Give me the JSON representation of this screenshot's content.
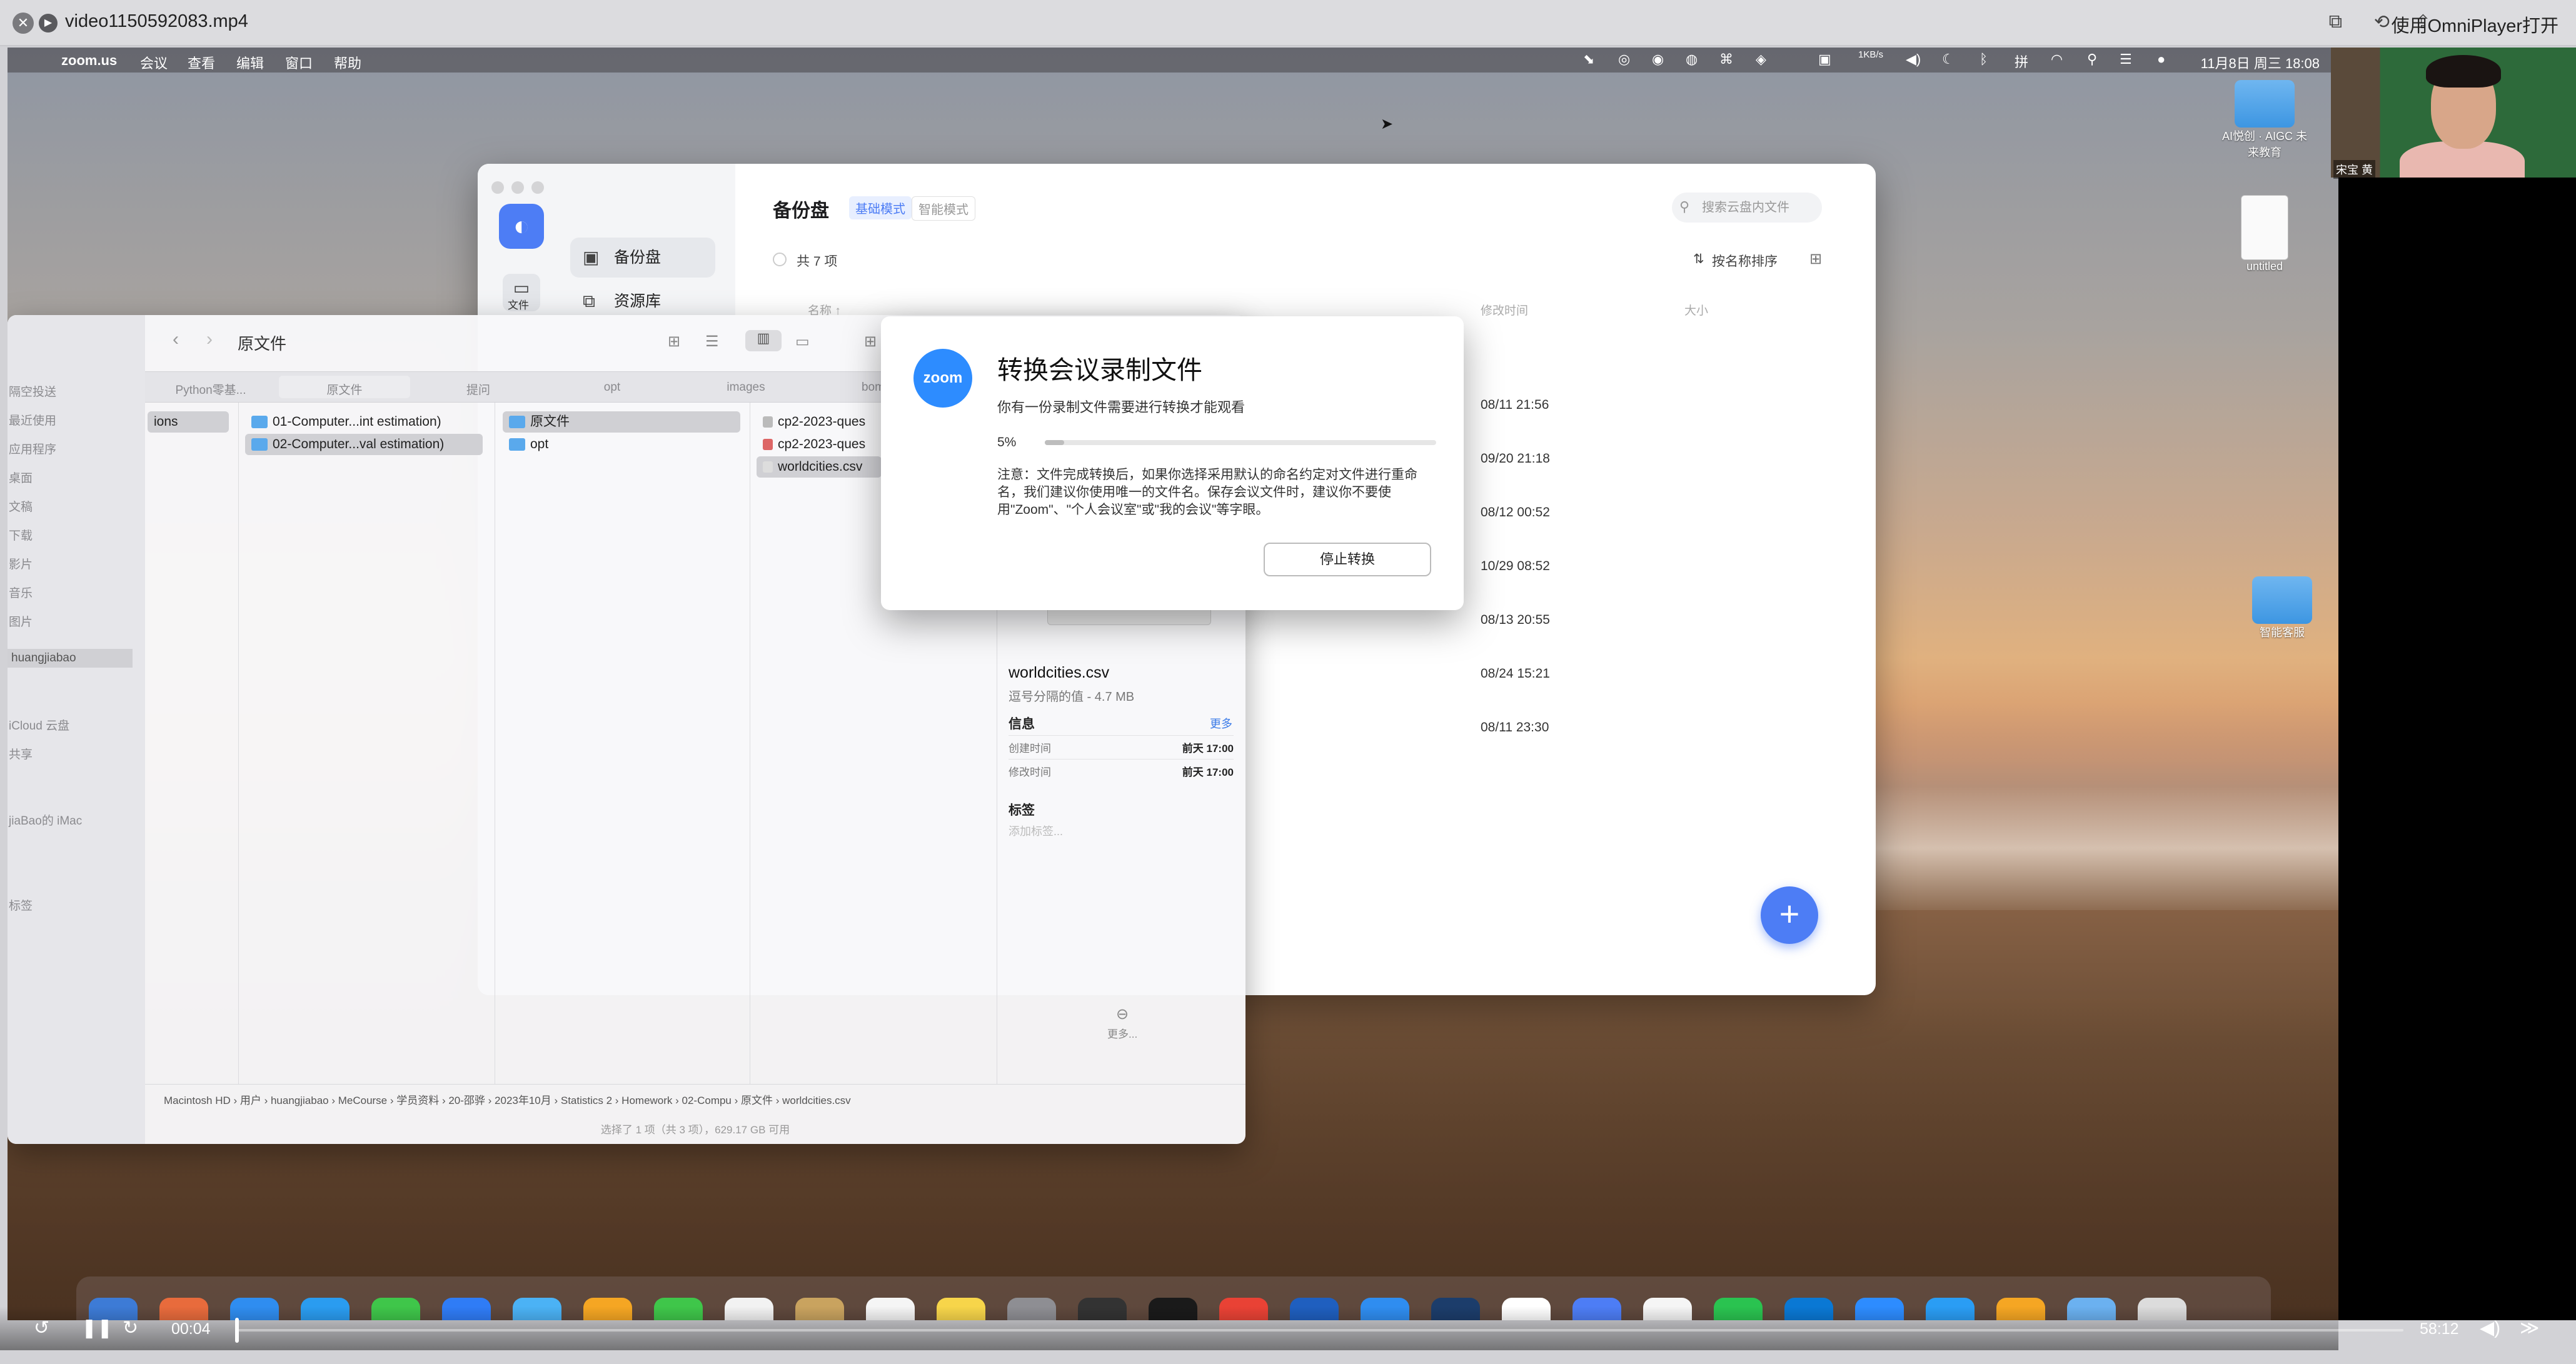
{
  "player": {
    "title": "video1150592083.mp4",
    "open_with": "使用OmniPlayer打开",
    "current_time": "00:04",
    "total_time": "58:12",
    "progress": 0.0011
  },
  "menubar": {
    "app": "zoom.us",
    "items": [
      "会议",
      "查看",
      "编辑",
      "窗口",
      "帮助"
    ],
    "net": "1KB/s",
    "clock": "11月8日 周三  18:08"
  },
  "webcam": {
    "name": "宋宝 黄"
  },
  "desktop_icons": [
    {
      "label": "AI悦创 · AIGC 未来教育",
      "kind": "folder"
    },
    {
      "label": "untitled",
      "kind": "document"
    },
    {
      "label": "智能客服",
      "kind": "folder"
    }
  ],
  "baidu": {
    "side": [
      {
        "label": "备份盘",
        "icon": "backup-icon"
      },
      {
        "label": "资源库",
        "icon": "library-icon"
      }
    ],
    "side_tab": "文件",
    "title": "备份盘",
    "mode_basic": "基础模式",
    "mode_smart": "智能模式",
    "search_placeholder": "搜索云盘内文件",
    "count": "共 7 项",
    "sort": "按名称排序",
    "col_name": "名称 ↑",
    "col_time": "修改时间",
    "col_size": "大小",
    "dates": [
      "08/11 21:56",
      "09/20 21:18",
      "08/12 00:52",
      "10/29 08:52",
      "08/13 20:55",
      "08/24 15:21",
      "08/11 23:30"
    ]
  },
  "finder": {
    "title": "原文件",
    "side": [
      "隔空投送",
      "最近使用",
      "应用程序",
      "桌面",
      "文稿",
      "下载",
      "影片",
      "音乐",
      "图片",
      "huangjiabao",
      "iCloud 云盘",
      "共享",
      "jiaBao的 iMac",
      "标签"
    ],
    "tabs": [
      "Python零基...",
      "原文件",
      "提问",
      "opt",
      "images",
      "bomba"
    ],
    "col1": [
      "ions"
    ],
    "col2": [
      "01-Computer...int estimation)",
      "02-Computer...val estimation)"
    ],
    "col3": [
      "原文件",
      "opt"
    ],
    "col4": [
      "cp2-2023-ques",
      "cp2-2023-ques",
      "worldcities.csv"
    ],
    "preview": {
      "thumb": "CSV",
      "name": "worldcities.csv",
      "type": "逗号分隔的值 - 4.7 MB",
      "info": "信息",
      "more": "更多",
      "created_label": "创建时间",
      "created": "前天 17:00",
      "modified_label": "修改时间",
      "modified": "前天 17:00",
      "tags": "标签",
      "add_tag": "添加标签...",
      "more_btn": "更多..."
    },
    "path": "Macintosh HD › 用户 › huangjiabao › MeCourse › 学员资料 › 20-邵骅 › 2023年10月 › Statistics 2 › Homework › 02-Compu › 原文件 › worldcities.csv",
    "status": "选择了 1 项（共 3 项），629.17 GB 可用"
  },
  "dialog": {
    "title": "转换会议录制文件",
    "message": "你有一份录制文件需要进行转换才能观看",
    "percent": "5%",
    "progress": 0.05,
    "note": "注意：文件完成转换后，如果你选择采用默认的命名约定对文件进行重命名，我们建议你使用唯一的文件名。保存会议文件时，建议你不要使用\"Zoom\"、\"个人会议室\"或\"我的会议\"等字眼。",
    "stop": "停止转换"
  },
  "dock_colors": [
    "#3d7bd6",
    "#e86b3c",
    "#2f8df0",
    "#2a9cf0",
    "#3fc64a",
    "#2f7cf6",
    "#4bb2f5",
    "#f5a623",
    "#3fc64a",
    "#f2f2f2",
    "#c9a35f",
    "#f5f5f5",
    "#f7d54a",
    "#8e8e93",
    "#333333",
    "#1a1a1a",
    "#e94235",
    "#1f5fbf",
    "#2f8df0",
    "#1c3d6b",
    "#ffffff",
    "#4d7df5",
    "#f5f5f5",
    "#2ac350",
    "#0a78d4",
    "#2d8cff",
    "#2a9df4",
    "#f5a623",
    "#6bb1f0",
    "#dcdcdc"
  ]
}
